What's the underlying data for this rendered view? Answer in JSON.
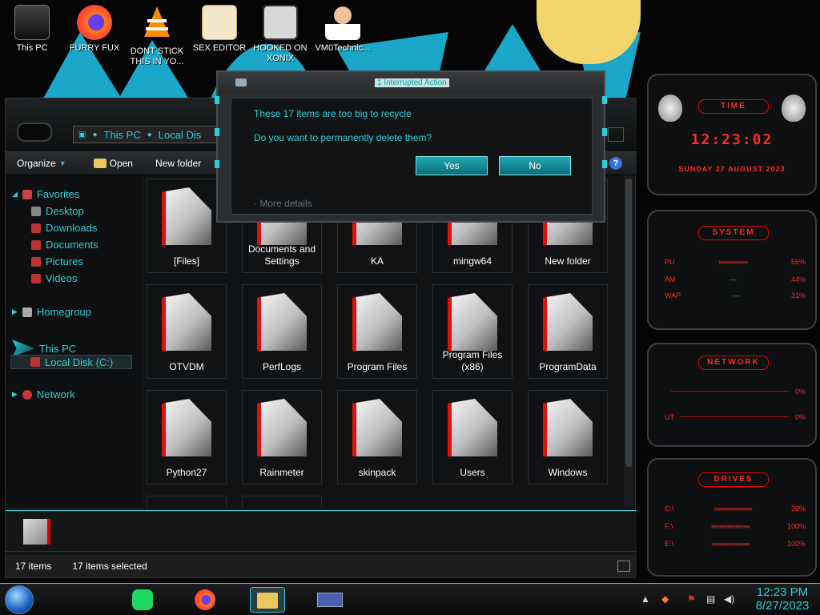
{
  "desktop": {
    "icons": [
      {
        "label": "This PC",
        "icon": "computer-icon"
      },
      {
        "label": "FURRY FUX",
        "icon": "firefox-icon"
      },
      {
        "label": "DONT STICK THIS IN YO...",
        "icon": "vlc-icon"
      },
      {
        "label": "SEX EDITOR",
        "icon": "hxd-icon"
      },
      {
        "label": "HOOKED ON XONIX",
        "icon": "xonix-icon"
      },
      {
        "label": "VM0Technic...",
        "icon": "doctor-icon"
      }
    ]
  },
  "explorer": {
    "breadcrumb": [
      "This PC",
      "Local Dis"
    ],
    "toolbar": {
      "organize": "Organize",
      "open": "Open",
      "new_folder": "New folder",
      "help": "?"
    },
    "nav": {
      "favorites": "Favorites",
      "favorites_items": [
        "Desktop",
        "Downloads",
        "Documents",
        "Pictures",
        "Videos"
      ],
      "homegroup": "Homegroup",
      "this_pc": "This PC",
      "local_disk": "Local Disk (C:)",
      "network": "Network"
    },
    "folders": [
      "[Files]",
      "Documents and Settings",
      "KA",
      "mingw64",
      "New folder",
      "OTVDM",
      "PerfLogs",
      "Program Files",
      "Program Files (x86)",
      "ProgramData",
      "Python27",
      "Rainmeter",
      "skinpack",
      "Users",
      "Windows"
    ],
    "status": {
      "items": "17 items",
      "selected": "17 items selected"
    }
  },
  "dialog": {
    "title": "1 Interrupted Action",
    "message": "These 17 items are too big to recycle",
    "question": "Do you want to permanently delete them?",
    "yes": "Yes",
    "no": "No",
    "more": "More details"
  },
  "rainmeter": {
    "time_title": "TIME",
    "time": "12:23:02",
    "date": "SUNDAY 27 AUGUST 2023",
    "system_title": "SYSTEM",
    "system_rows": [
      {
        "label": "PU",
        "value": "56%"
      },
      {
        "label": "AM",
        "value": "44%"
      },
      {
        "label": "WAP",
        "value": "31%"
      }
    ],
    "network_title": "NETWORK",
    "network_rows": [
      {
        "label": "",
        "value": "0%"
      },
      {
        "label": "UT",
        "value": "0%"
      }
    ],
    "drives_title": "DRIVES",
    "drives_rows": [
      {
        "label": "C:\\",
        "value": "38%"
      },
      {
        "label": "F:\\",
        "value": "100%"
      },
      {
        "label": "E:\\",
        "value": "100%"
      }
    ]
  },
  "taskbar": {
    "time": "12:23 PM",
    "date": "8/27/2023"
  },
  "colors": {
    "accent": "#2ad0d8",
    "rainmeter_red": "#ff2a2a"
  }
}
